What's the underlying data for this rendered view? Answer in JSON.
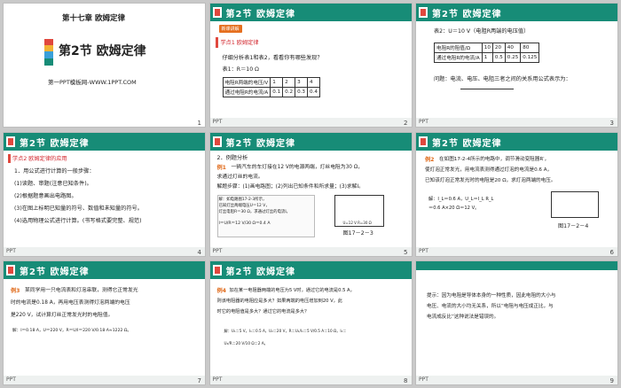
{
  "s1": {
    "chapter": "第十七章  欧姆定律",
    "title": "第2节   欧姆定律",
    "site": "第一PPT模板网-WWW.1PPT.COM",
    "page": "1"
  },
  "s2": {
    "header": "第2节   欧姆定律",
    "tag": "新课讲解",
    "section": "学点1  欧姆定律",
    "question": "仔细分析表1和表2，看看你有哪些发现？",
    "table_caption": "表1：R＝10 Ω",
    "rows": [
      [
        "电阻R两端的电压/V",
        "1",
        "2",
        "3",
        "4"
      ],
      [
        "通过电阻R的电流/A",
        "0.1",
        "0.2",
        "0.3",
        "0.4"
      ]
    ],
    "page": "2"
  },
  "s3": {
    "header": "第2节   欧姆定律",
    "table_caption": "表2：U＝10 V（电阻R两端的电压值）",
    "rows": [
      [
        "电阻R的阻值/Ω",
        "10",
        "20",
        "40",
        "80"
      ],
      [
        "通过电阻R的电流/A",
        "1",
        "0.5",
        "0.25",
        "0.125"
      ]
    ],
    "question": "问题：电流、电压、电阻三者之间的关系用公式表示为：",
    "page": "3"
  },
  "s4": {
    "header": "第2节   欧姆定律",
    "section": "学点2  欧姆定律的应用",
    "lines": [
      "1．用公式进行计算的一般步骤：",
      "(1)读题、审题(注意已知条件)。",
      "(2)根据题意画出电路图。",
      "(3)在图上标明已知量的符号、数值和未知量的符号。",
      "(4)选用物理公式进行计算。(书写格式要完整、规范)"
    ],
    "page": "4"
  },
  "s5": {
    "header": "第2节   欧姆定律",
    "sub": "2．例题分析",
    "label": "例1",
    "lines": [
      "一辆汽车的车灯接在12 V的电源两端，灯丝电阻为30 Ω，",
      "求通过灯丝的电流。",
      "解题步骤：(1)画电路图；(2)列出已知条件和所求量；(3)求解I。"
    ],
    "ans": [
      "解：如电路图17-2-3所示，",
      "已知灯丝两端电压U＝12 V，",
      "灯丝电阻R＝30 Ω，求通过灯丝的电流I。",
      "I＝U/R＝12 V/30 Ω＝0.4 A"
    ],
    "fig": "图17－2－3",
    "circ": "U=12 V  R=30 Ω",
    "page": "5"
  },
  "s6": {
    "header": "第2节   欧姆定律",
    "label": "例2",
    "lines": [
      "在如图17-2-4所示的电路中，调节滑动变阻器R′，",
      "使灯泡正常发光，用电流表测得通过灯泡的电流是0.6 A，",
      "已知该灯泡正常发光时的电阻是20 Ω，求灯泡两端的电压。"
    ],
    "ans": [
      "解：I_L＝0.6 A，U_L＝I_L R_L",
      "＝0.6 A×20 Ω＝12 V。"
    ],
    "fig": "图17－2－4",
    "page": "6"
  },
  "s7": {
    "header": "第2节   欧姆定律",
    "label": "例3",
    "lines": [
      "某同学用一只电流表和灯泡串联，测得它正常发光",
      "时的电流是0.18 A，再用电压表测得灯泡两端的电压",
      "是220 V，试计算灯丝正常发光时的电阻值。"
    ],
    "ans": "解：I＝0.18 A，U＝220 V，R＝U/I＝220 V/0.18 A≈1222 Ω。",
    "page": "7"
  },
  "s8": {
    "header": "第2节   欧姆定律",
    "label": "例4",
    "lines": [
      "加在某一电阻器两端的电压为5 V时，通过它的电流是0.5 A，",
      "则该电阻器的电阻应是多大？如果两端的电压增加到20 V，此",
      "时它的电阻值是多大？通过它的电流是多大？"
    ],
    "ans1": "解：U₁＝5 V，I₁＝0.5 A，U₂＝20 V，R＝U₁/I₁＝5 V/0.5 A＝10 Ω，I₂＝",
    "ans2": "U₂/R＝20 V/10 Ω＝2 A。",
    "page": "8"
  },
  "s9": {
    "lines": [
      "提示：因为电阻是导体本身的一种性质，因此电阻的大小与",
      "电压、电流的大小均无关系，所以“电阻与电压成正比，与",
      "电流成反比”这种说法是错误的。"
    ],
    "page": "9"
  },
  "footer_logo": "PPT"
}
